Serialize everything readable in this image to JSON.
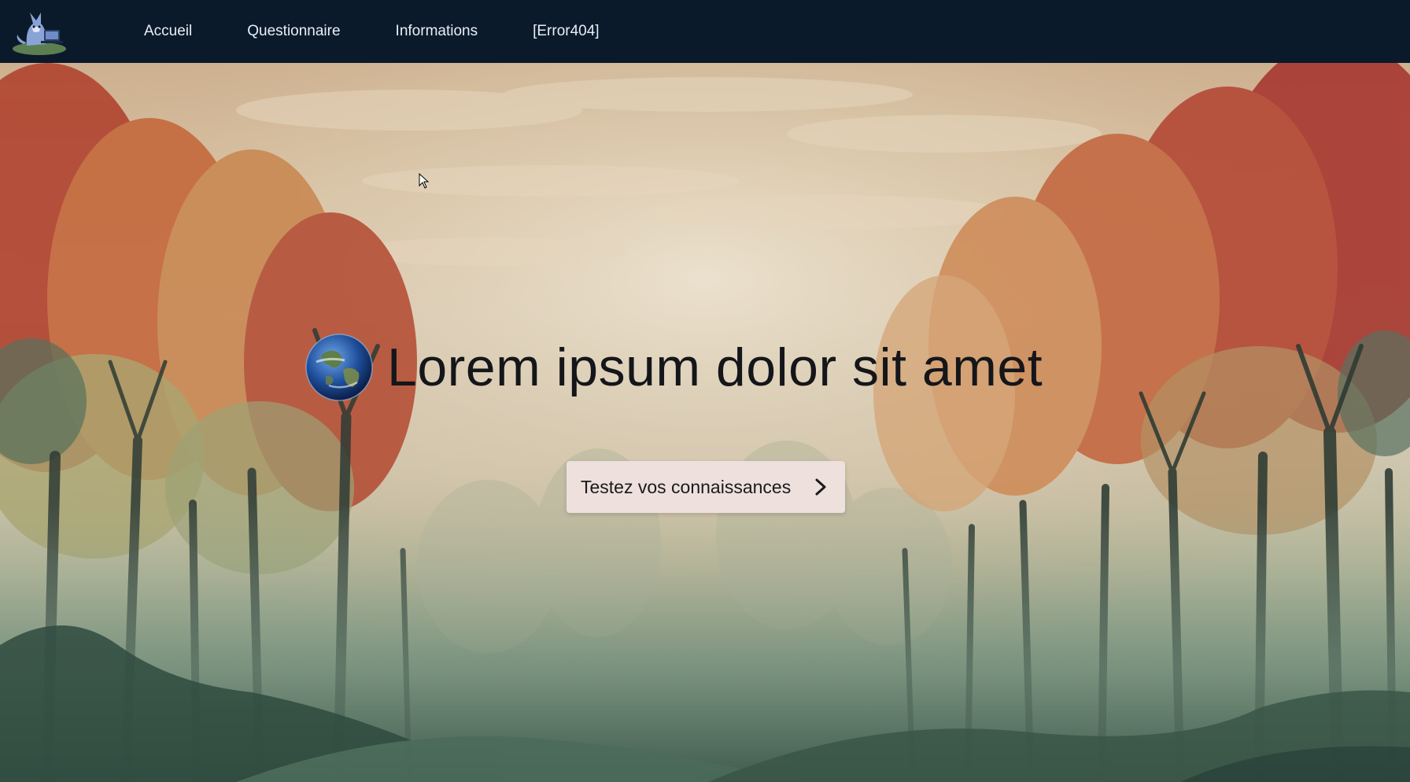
{
  "nav": {
    "logo_icon": "fox-laptop-logo-icon",
    "links": [
      {
        "label": "Accueil"
      },
      {
        "label": "Questionnaire"
      },
      {
        "label": "Informations"
      },
      {
        "label": "[Error404]"
      }
    ]
  },
  "hero": {
    "globe_icon": "earth-globe-icon",
    "title": "Lorem ipsum dolor sit amet",
    "cta": {
      "label": "Testez vos connaissances",
      "icon": "chevron-right-icon"
    },
    "background": "painted-forest-illustration"
  },
  "colors": {
    "navbar_bg": "#0b1a2b",
    "nav_text": "#e8eef5",
    "cta_bg": "#ede0dd",
    "title_text": "#14161a"
  }
}
